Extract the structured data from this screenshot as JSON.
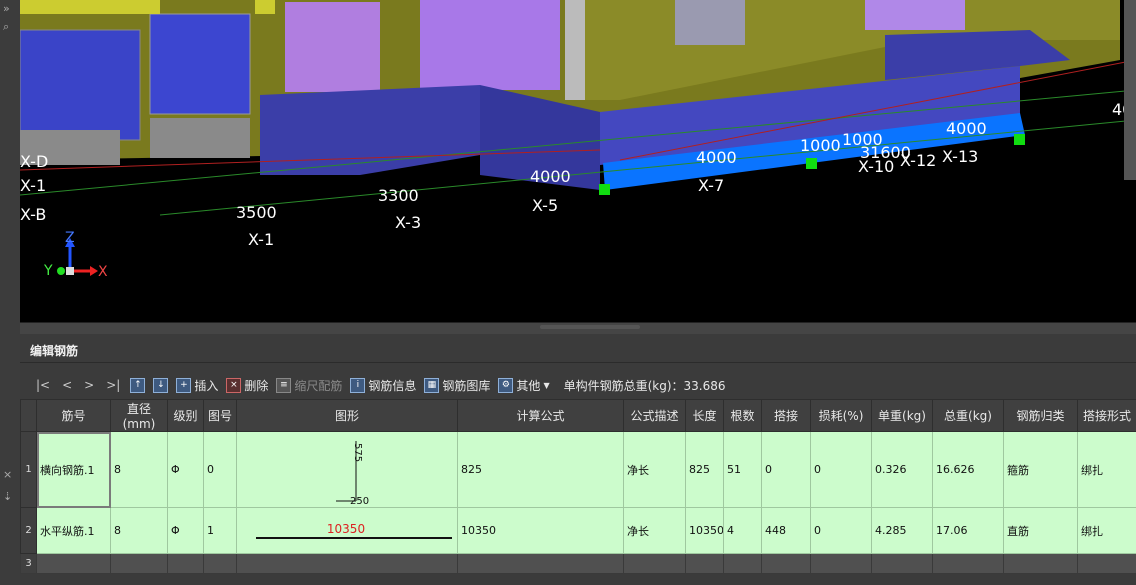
{
  "viewport": {
    "axis_labels": [
      {
        "text": "X-D"
      },
      {
        "text": "X-1"
      },
      {
        "text": "X-B"
      },
      {
        "text": "X-1"
      },
      {
        "text": "X-3"
      },
      {
        "text": "X-5"
      },
      {
        "text": "X-7"
      },
      {
        "text": "X-10"
      },
      {
        "text": "X-12"
      },
      {
        "text": "X-13"
      }
    ],
    "dimensions": [
      {
        "text": "3500"
      },
      {
        "text": "3300"
      },
      {
        "text": "4000"
      },
      {
        "text": "4000"
      },
      {
        "text": "1000"
      },
      {
        "text": "1000"
      },
      {
        "text": "31600"
      },
      {
        "text": "4000"
      },
      {
        "text": "40"
      }
    ],
    "gizmo": {
      "z": "Z",
      "y": "Y",
      "x": "X"
    }
  },
  "panel": {
    "title": "编辑钢筋",
    "toolbar": {
      "nav_first": "|<",
      "nav_prev": "<",
      "nav_next": ">",
      "nav_last": ">|",
      "insert": "插入",
      "delete": "删除",
      "scale_rebar": "缩尺配筋",
      "rebar_info": "钢筋信息",
      "rebar_library": "钢筋图库",
      "other": "其他",
      "total_weight": "单构件钢筋总重(kg)：33.686"
    },
    "columns": [
      "筋号",
      "直径(mm)",
      "级别",
      "图号",
      "图形",
      "计算公式",
      "公式描述",
      "长度",
      "根数",
      "搭接",
      "损耗(%)",
      "单重(kg)",
      "总重(kg)",
      "钢筋归类",
      "搭接形式"
    ],
    "rows": [
      {
        "num": "1",
        "name": "横向钢筋.1",
        "diameter": "8",
        "grade": "Φ",
        "shape_no": "0",
        "shape_top": "575",
        "shape_bottom": "250",
        "formula": "825",
        "desc": "净长",
        "length": "825",
        "count": "51",
        "lap": "0",
        "loss": "0",
        "unit_weight": "0.326",
        "total_weight": "16.626",
        "category": "箍筋",
        "lap_type": "绑扎"
      },
      {
        "num": "2",
        "name": "水平纵筋.1",
        "diameter": "8",
        "grade": "Φ",
        "shape_no": "1",
        "shape_label": "10350",
        "formula": "10350",
        "desc": "净长",
        "length": "10350",
        "count": "4",
        "lap": "448",
        "loss": "0",
        "unit_weight": "4.285",
        "total_weight": "17.06",
        "category": "直筋",
        "lap_type": "绑扎"
      },
      {
        "num": "3"
      }
    ]
  }
}
